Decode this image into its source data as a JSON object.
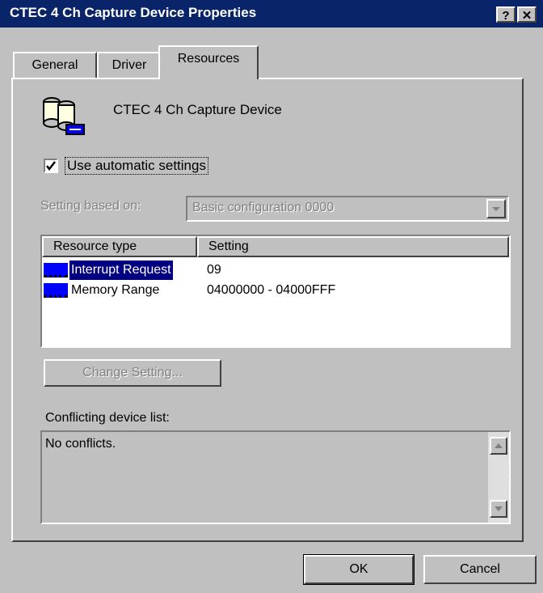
{
  "window": {
    "title": "CTEC 4 Ch Capture Device Properties",
    "help_button": "?",
    "close_button": "✕"
  },
  "tabs": [
    {
      "label": "General",
      "active": false
    },
    {
      "label": "Driver",
      "active": false
    },
    {
      "label": "Resources",
      "active": true
    }
  ],
  "device": {
    "name": "CTEC 4 Ch Capture Device",
    "icon": "capture-device-icon"
  },
  "auto_settings": {
    "label": "Use automatic settings",
    "checked": true
  },
  "setting_based_on": {
    "label": "Setting based on:",
    "value": "Basic configuration 0000"
  },
  "resources_table": {
    "headers": [
      "Resource type",
      "Setting"
    ],
    "rows": [
      {
        "type": "Interrupt Request",
        "setting": "09",
        "selected": true
      },
      {
        "type": "Memory Range",
        "setting": "04000000 - 04000FFF",
        "selected": false
      }
    ]
  },
  "change_setting_button": "Change Setting...",
  "conflicts": {
    "label": "Conflicting device list:",
    "text": "No conflicts."
  },
  "footer": {
    "ok": "OK",
    "cancel": "Cancel"
  },
  "colors": {
    "title_bar": "#0a246a",
    "face": "#c0c0c0",
    "selection": "#000080"
  }
}
